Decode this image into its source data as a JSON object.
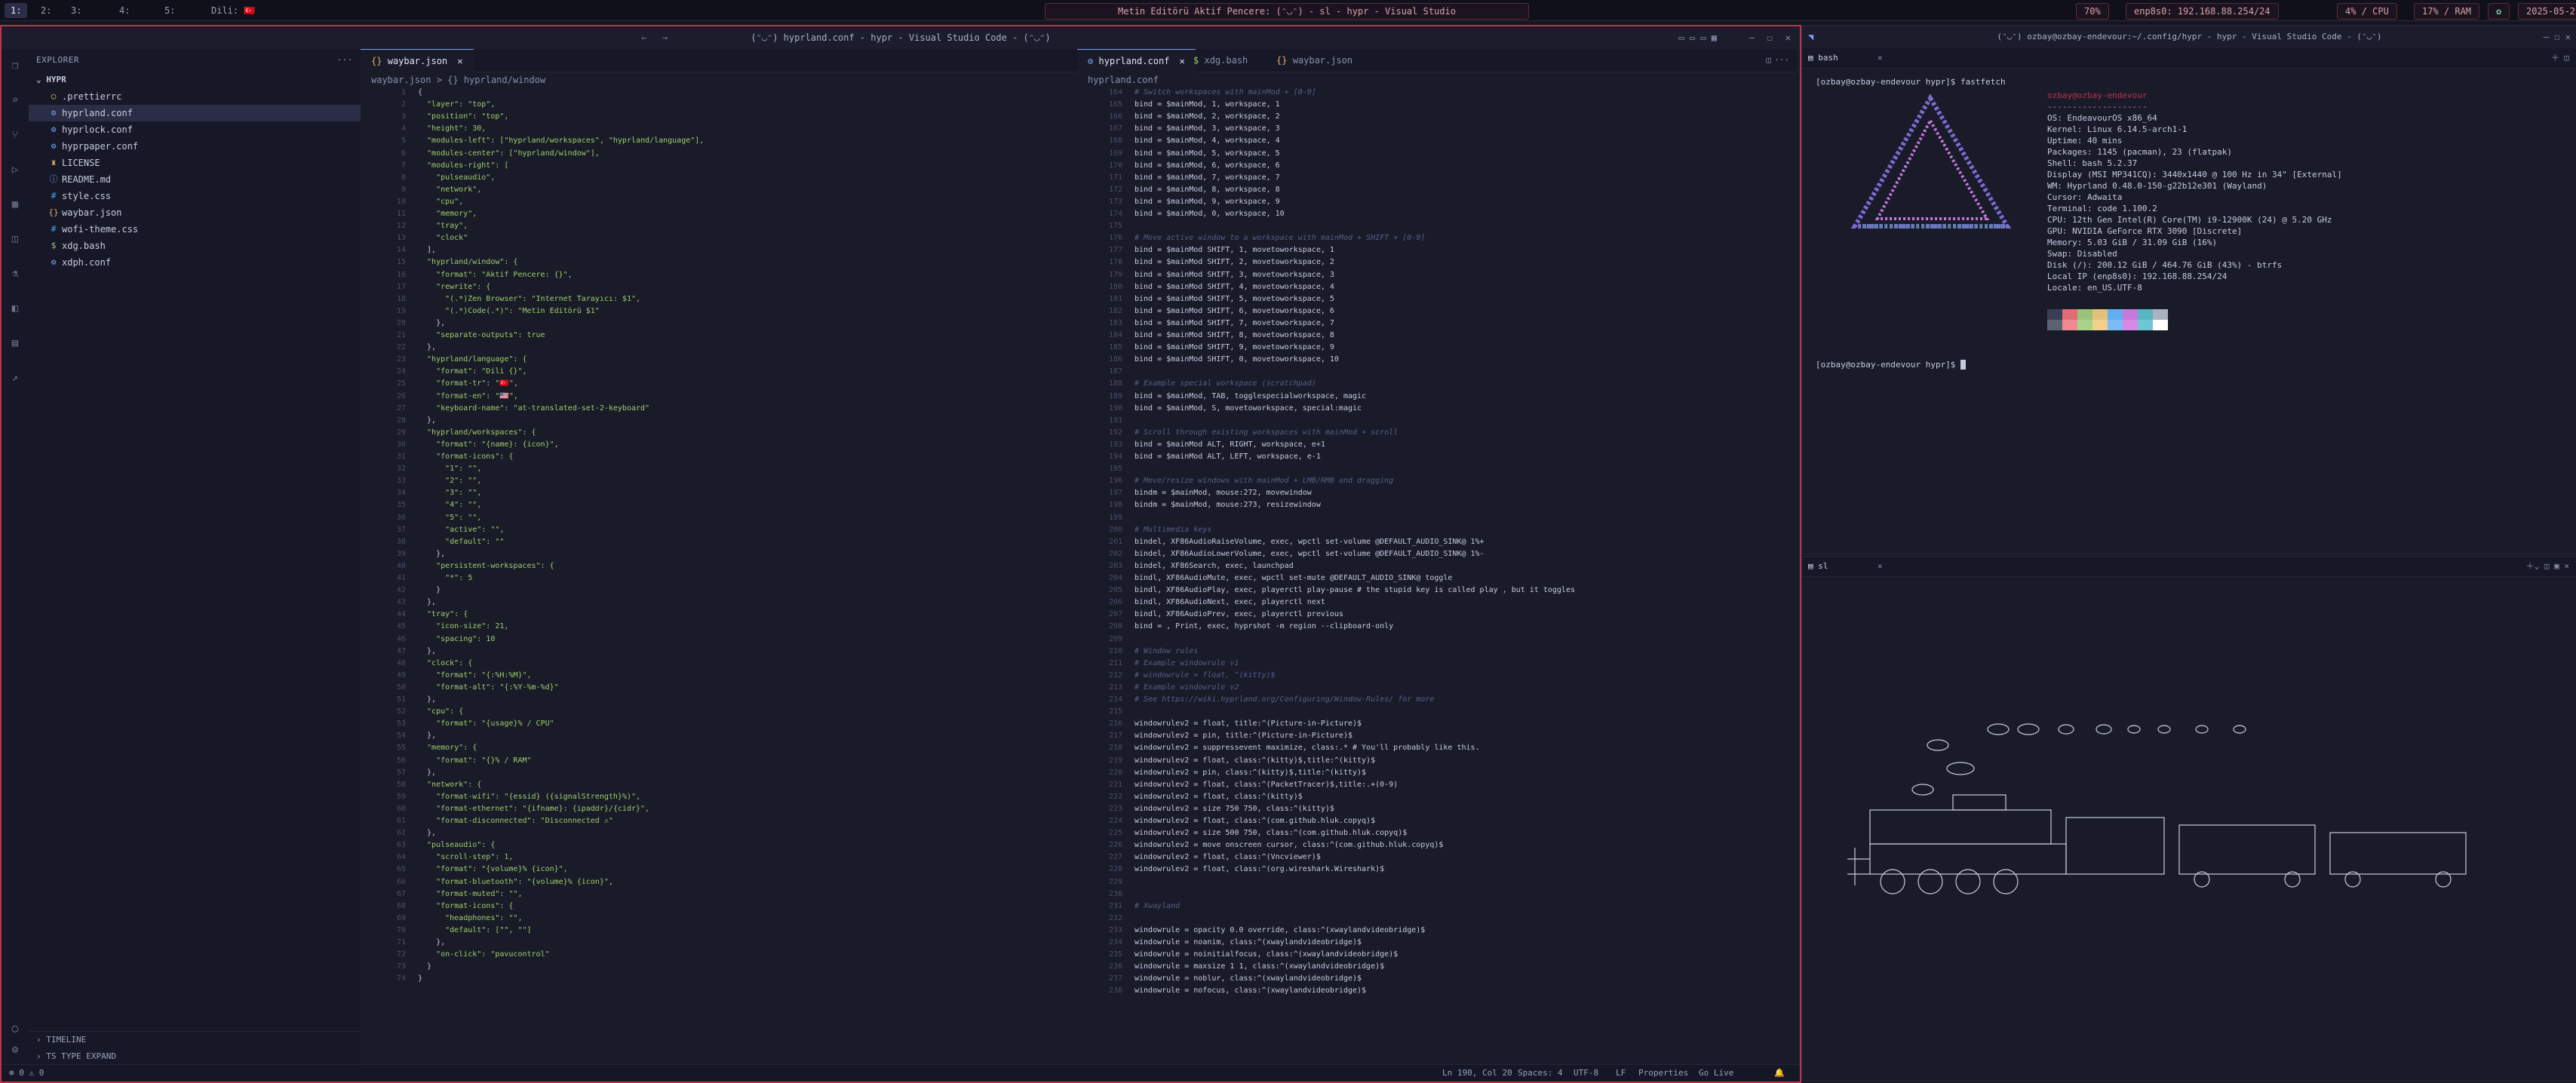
{
  "topbar": {
    "workspaces": [
      "1: ",
      "2: ",
      "3: ",
      "4: ",
      "5: "
    ],
    "lang": "Dili: ",
    "flag": "🇹🇷",
    "window_title": "Metin Editörü Aktif Pencere: (ᵔ◡ᵔ) - sl - hypr - Visual Studio",
    "volume": "70%",
    "network": "enp8s0: 192.168.88.254/24",
    "cpu": "4% / CPU",
    "ram": "17% / RAM",
    "date": "2025-05-2"
  },
  "vscode": {
    "title": "(ᵔ◡ᵔ) hyprland.conf - hypr - Visual Studio Code - (ᵔ◡ᵔ)",
    "explorer_label": "EXPLORER",
    "folder": "HYPR",
    "files": [
      ".prettierrc",
      "hyprland.conf",
      "hyprlock.conf",
      "hyprpaper.conf",
      "LICENSE",
      "README.md",
      "style.css",
      "waybar.json",
      "wofi-theme.css",
      "xdg.bash",
      "xdph.conf"
    ],
    "timeline": "TIMELINE",
    "todos": "TS TYPE EXPAND",
    "left_tab": "waybar.json",
    "left_crumbs": "waybar.json > {} hyprland/window",
    "right_tabs": [
      "hyprland.conf",
      "xdg.bash",
      "waybar.json"
    ],
    "right_crumbs": "hyprland.conf",
    "status_left": "⊗ 0 ⚠ 0",
    "status_items": [
      "Ln 190, Col 20",
      "Spaces: 4",
      "UTF-8",
      "LF",
      "Properties",
      "Go Live"
    ]
  },
  "waybar_code": [
    "{",
    "  \"layer\": \"top\",",
    "  \"position\": \"top\",",
    "  \"height\": 30,",
    "  \"modules-left\": [\"hyprland/workspaces\", \"hyprland/language\"],",
    "  \"modules-center\": [\"hyprland/window\"],",
    "  \"modules-right\": [",
    "    \"pulseaudio\",",
    "    \"network\",",
    "    \"cpu\",",
    "    \"memory\",",
    "    \"tray\",",
    "    \"clock\"",
    "  ],",
    "  \"hyprland/window\": {",
    "    \"format\": \"Aktif Pencere: {}\",",
    "    \"rewrite\": {",
    "      \"(.*)Zen Browser\": \"Internet Tarayıcı: $1\",",
    "      \"(.*)Code(.*)\": \"Metin Editörü $1\"",
    "    },",
    "    \"separate-outputs\": true",
    "  },",
    "  \"hyprland/language\": {",
    "    \"format\": \"Dili {}\",",
    "    \"format-tr\": \"🇹🇷\",",
    "    \"format-en\": \"🇺🇸\",",
    "    \"keyboard-name\": \"at-translated-set-2-keyboard\"",
    "  },",
    "  \"hyprland/workspaces\": {",
    "    \"format\": \"{name}: {icon}\",",
    "    \"format-icons\": {",
    "      \"1\": \"\",",
    "      \"2\": \"\",",
    "      \"3\": \"\",",
    "      \"4\": \"\",",
    "      \"5\": \"\",",
    "      \"active\": \"\",",
    "      \"default\": \"\"",
    "    },",
    "    \"persistent-workspaces\": {",
    "      \"*\": 5",
    "    }",
    "  },",
    "  \"tray\": {",
    "    \"icon-size\": 21,",
    "    \"spacing\": 10",
    "  },",
    "  \"clock\": {",
    "    \"format\": \"{:%H:%M}\",",
    "    \"format-alt\": \"{:%Y-%m-%d}\"",
    "  },",
    "  \"cpu\": {",
    "    \"format\": \"{usage}% / CPU\"",
    "  },",
    "  \"memory\": {",
    "    \"format\": \"{}% / RAM\"",
    "  },",
    "  \"network\": {",
    "    \"format-wifi\": \"{essid} ({signalStrength}%)\",",
    "    \"format-ethernet\": \"{ifname}: {ipaddr}/{cidr}\",",
    "    \"format-disconnected\": \"Disconnected ⚠\"",
    "  },",
    "  \"pulseaudio\": {",
    "    \"scroll-step\": 1,",
    "    \"format\": \"{volume}% {icon}\",",
    "    \"format-bluetooth\": \"{volume}% {icon}\",",
    "    \"format-muted\": \"\",",
    "    \"format-icons\": {",
    "      \"headphones\": \"\",",
    "      \"default\": [\"\", \"\"]",
    "    },",
    "    \"on-click\": \"pavucontrol\"",
    "  }",
    "}"
  ],
  "hypr_code": [
    "# Switch workspaces with mainMod + [0-9]",
    "bind = $mainMod, 1, workspace, 1",
    "bind = $mainMod, 2, workspace, 2",
    "bind = $mainMod, 3, workspace, 3",
    "bind = $mainMod, 4, workspace, 4",
    "bind = $mainMod, 5, workspace, 5",
    "bind = $mainMod, 6, workspace, 6",
    "bind = $mainMod, 7, workspace, 7",
    "bind = $mainMod, 8, workspace, 8",
    "bind = $mainMod, 9, workspace, 9",
    "bind = $mainMod, 0, workspace, 10",
    "",
    "# Move active window to a workspace with mainMod + SHIFT + [0-9]",
    "bind = $mainMod SHIFT, 1, movetoworkspace, 1",
    "bind = $mainMod SHIFT, 2, movetoworkspace, 2",
    "bind = $mainMod SHIFT, 3, movetoworkspace, 3",
    "bind = $mainMod SHIFT, 4, movetoworkspace, 4",
    "bind = $mainMod SHIFT, 5, movetoworkspace, 5",
    "bind = $mainMod SHIFT, 6, movetoworkspace, 6",
    "bind = $mainMod SHIFT, 7, movetoworkspace, 7",
    "bind = $mainMod SHIFT, 8, movetoworkspace, 8",
    "bind = $mainMod SHIFT, 9, movetoworkspace, 9",
    "bind = $mainMod SHIFT, 0, movetoworkspace, 10",
    "",
    "# Example special workspace (scratchpad)",
    "bind = $mainMod, TAB, togglespecialworkspace, magic",
    "bind = $mainMod, S, movetoworkspace, special:magic",
    "",
    "# Scroll through existing workspaces with mainMod + scroll",
    "bind = $mainMod ALT, RIGHT, workspace, e+1",
    "bind = $mainMod ALT, LEFT, workspace, e-1",
    "",
    "# Move/resize windows with mainMod + LMB/RMB and dragging",
    "bindm = $mainMod, mouse:272, movewindow",
    "bindm = $mainMod, mouse:273, resizewindow",
    "",
    "# Multimedia keys",
    "bindel, XF86AudioRaiseVolume, exec, wpctl set-volume @DEFAULT_AUDIO_SINK@ 1%+",
    "bindel, XF86AudioLowerVolume, exec, wpctl set-volume @DEFAULT_AUDIO_SINK@ 1%-",
    "bindel, XF86Search, exec, launchpad",
    "bindl, XF86AudioMute, exec, wpctl set-mute @DEFAULT_AUDIO_SINK@ toggle",
    "bindl, XF86AudioPlay, exec, playerctl play-pause # the stupid key is called play , but it toggles",
    "bindl, XF86AudioNext, exec, playerctl next",
    "bindl, XF86AudioPrev, exec, playerctl previous",
    "bind = , Print, exec, hyprshot -m region --clipboard-only",
    "",
    "# Window rules",
    "# Example windowrule v1",
    "# windowrule = float, ^(kitty)$",
    "# Example windowrule v2",
    "# See https://wiki.hyprland.org/Configuring/Window-Rules/ for more",
    "",
    "windowrulev2 = float, title:^(Picture-in-Picture)$",
    "windowrulev2 = pin, title:^(Picture-in-Picture)$",
    "windowrulev2 = suppressevent maximize, class:.* # You'll probably like this.",
    "windowrulev2 = float, class:^(kitty)$,title:^(kitty)$",
    "windowrulev2 = pin, class:^(kitty)$,title:^(kitty)$",
    "windowrulev2 = float, class:^(PacketTracer)$,title:.+(0-9)",
    "windowrulev2 = float, class:^(kitty)$",
    "windowrulev2 = size 750 750, class:^(kitty)$",
    "windowrulev2 = float, class:^(com.github.hluk.copyq)$",
    "windowrulev2 = size 500 750, class:^(com.github.hluk.copyq)$",
    "windowrulev2 = move onscreen cursor, class:^(com.github.hluk.copyq)$",
    "windowrulev2 = float, class:^(Vncviewer)$",
    "windowrulev2 = float, class:^(org.wireshark.Wireshark)$",
    "",
    "",
    "# Xwayland",
    "",
    "windowrule = opacity 0.0 override, class:^(xwaylandvideobridge)$",
    "windowrule = noanim, class:^(xwaylandvideobridge)$",
    "windowrule = noinitialfocus, class:^(xwaylandvideobridge)$",
    "windowrule = maxsize 1 1, class:^(xwaylandvideobridge)$",
    "windowrule = noblur, class:^(xwaylandvideobridge)$",
    "windowrule = nofocus, class:^(xwaylandvideobridge)$"
  ],
  "hypr_start_line": 164,
  "terminal_top": {
    "tab": "bash",
    "title": "(ᵔ◡ᵔ) ozbay@ozbay-endevour:~/.config/hypr - hypr - Visual Studio Code - (ᵔ◡ᵔ)",
    "prompt1": "[ozbay@ozbay-endevour hypr]$ fastfetch",
    "user_host": "ozbay@ozbay-endevour",
    "sep": "--------------------",
    "info": [
      "OS: EndeavourOS x86_64",
      "Kernel: Linux 6.14.5-arch1-1",
      "Uptime: 40 mins",
      "Packages: 1145 (pacman), 23 (flatpak)",
      "Shell: bash 5.2.37",
      "Display (MSI MP341CQ): 3440x1440 @ 100 Hz in 34\" [External]",
      "WM: Hyprland 0.48.0-150-g22b12e301 (Wayland)",
      "Cursor: Adwaita",
      "Terminal: code 1.100.2",
      "CPU: 12th Gen Intel(R) Core(TM) i9-12900K (24) @ 5.20 GHz",
      "GPU: NVIDIA GeForce RTX 3090 [Discrete]",
      "Memory: 5.03 GiB / 31.09 GiB (16%)",
      "Swap: Disabled",
      "Disk (/): 200.12 GiB / 464.76 GiB (43%) - btrfs",
      "Local IP (enp8s0): 192.168.88.254/24",
      "Locale: en_US.UTF-8"
    ],
    "prompt2": "[ozbay@ozbay-endevour hypr]$ ",
    "palette": [
      "#3b3f56",
      "#e06c75",
      "#98c379",
      "#e5c07b",
      "#61afef",
      "#c678dd",
      "#56b6c2",
      "#abb2bf",
      "#5c6370",
      "#ef8a94",
      "#a8d389",
      "#f0d08b",
      "#7cbcf5",
      "#d68ae5",
      "#70c6d2",
      "#ffffff"
    ]
  },
  "terminal_bottom": {
    "tab": "sl"
  },
  "colors": {
    "accent": "#c2304a",
    "bg": "#141521",
    "logo": "#7a6bd1"
  }
}
